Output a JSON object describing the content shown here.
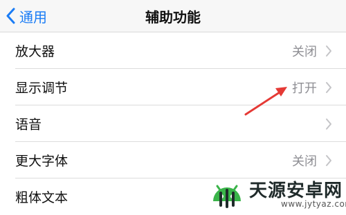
{
  "navbar": {
    "back_label": "通用",
    "title": "辅助功能"
  },
  "rows": [
    {
      "label": "放大器",
      "value": "关闭"
    },
    {
      "label": "显示调节",
      "value": "打开"
    },
    {
      "label": "语音",
      "value": ""
    },
    {
      "label": "更大字体",
      "value": "关闭"
    },
    {
      "label": "粗体文本",
      "value": ""
    }
  ],
  "watermark": {
    "name": "天源安卓网",
    "url": "www.jytyaz.com"
  },
  "colors": {
    "accent": "#1a7cf5",
    "secondary_text": "#8e8e93",
    "annotation_arrow": "#e53935",
    "logo_green": "#3ab449"
  }
}
